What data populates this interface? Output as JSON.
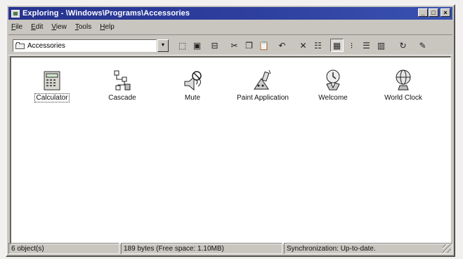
{
  "window": {
    "title": "Exploring - \\Windows\\Programs\\Accessories",
    "buttons": {
      "minimize": "_",
      "maximize": "□",
      "close": "×"
    }
  },
  "menu": [
    {
      "label": "File",
      "accel": "F",
      "rest": "ile"
    },
    {
      "label": "Edit",
      "accel": "E",
      "rest": "dit"
    },
    {
      "label": "View",
      "accel": "V",
      "rest": "iew"
    },
    {
      "label": "Tools",
      "accel": "T",
      "rest": "ools"
    },
    {
      "label": "Help",
      "accel": "H",
      "rest": "elp"
    }
  ],
  "address": {
    "value": "Accessories",
    "icon": "folder-icon"
  },
  "toolbar": {
    "buttons": [
      {
        "name": "up-folder-icon",
        "glyph": "⬚"
      },
      {
        "name": "map-drive-icon",
        "glyph": "▣"
      },
      {
        "name": "disconnect-drive-icon",
        "glyph": "⊟"
      },
      {
        "name": "cut-icon",
        "glyph": "✂"
      },
      {
        "name": "copy-icon",
        "glyph": "❐"
      },
      {
        "name": "paste-icon",
        "glyph": "📋"
      },
      {
        "name": "undo-icon",
        "glyph": "↶"
      },
      {
        "name": "delete-icon",
        "glyph": "✕"
      },
      {
        "name": "properties-icon",
        "glyph": "☷"
      },
      {
        "name": "large-icons-icon",
        "glyph": "▦"
      },
      {
        "name": "small-icons-icon",
        "glyph": "⁝"
      },
      {
        "name": "list-icon",
        "glyph": "☰"
      },
      {
        "name": "details-icon",
        "glyph": "▥"
      },
      {
        "name": "sync-icon",
        "glyph": "↻"
      },
      {
        "name": "paint-icon",
        "glyph": "✎"
      }
    ]
  },
  "items": [
    {
      "label": "Calculator",
      "icon": "calculator-icon",
      "selected": true
    },
    {
      "label": "Cascade",
      "icon": "cascade-icon"
    },
    {
      "label": "Mute",
      "icon": "mute-icon"
    },
    {
      "label": "Paint Application",
      "icon": "paint-icon"
    },
    {
      "label": "Welcome",
      "icon": "welcome-icon"
    },
    {
      "label": "World Clock",
      "icon": "world-clock-icon"
    }
  ],
  "status": {
    "count": "6 object(s)",
    "size": "189 bytes (Free space: 1.10MB)",
    "sync": "Synchronization: Up-to-date."
  }
}
